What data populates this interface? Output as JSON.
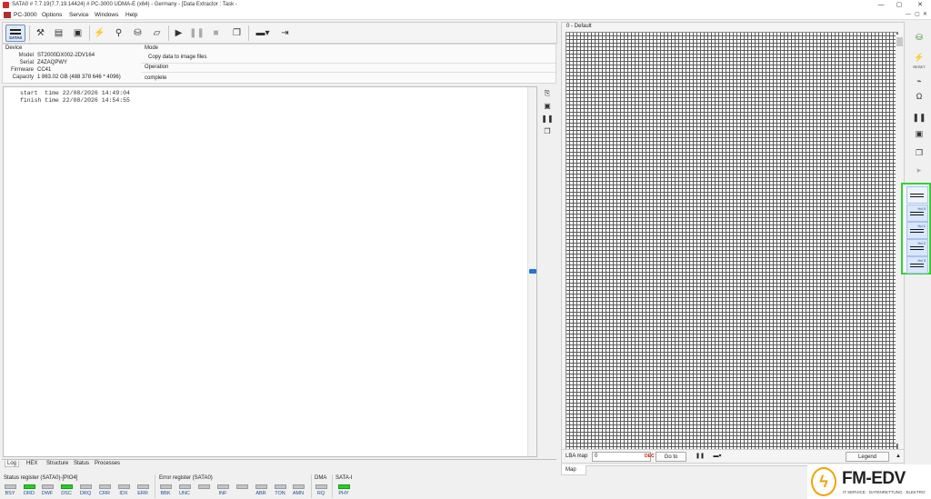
{
  "window": {
    "title": "SATA0 # 7.7.19(7.7.19.14424) # PC-3000 UDMA-E (x64) - Germany - [Data Extractor : Task - ",
    "controls": [
      "—",
      "▢",
      "✕"
    ]
  },
  "menu": {
    "items": [
      "PC-3000",
      "Options",
      "Service",
      "Windows",
      "Help"
    ],
    "sub_controls": [
      "—",
      "▢",
      "✕"
    ]
  },
  "toolbar": {
    "sata_label": "SATA0"
  },
  "device": {
    "section_label": "Device",
    "fields": [
      {
        "key": "Model",
        "value": "ST2000DX002-2DV164"
      },
      {
        "key": "Serial",
        "value": "Z4ZAQPWY"
      },
      {
        "key": "Firmware",
        "value": "CC41"
      },
      {
        "key": "Capacity",
        "value": "1 863.02 GB (488 378 646 * 4096)"
      }
    ],
    "mode_label": "Mode",
    "mode_value": "Copy data to image files",
    "operation_label": "Operation",
    "operation_value": "complete"
  },
  "log": {
    "lines": [
      "start  time 22/08/2026 14:49:04",
      "finish time 22/08/2026 14:54:55"
    ]
  },
  "tabs": [
    "Log",
    "HEX",
    "Structure",
    "Status",
    "Processes"
  ],
  "status_register": {
    "title": "Status register (SATA0)-[PIO4]",
    "leds": [
      {
        "label": "BSY",
        "on": false
      },
      {
        "label": "DRD",
        "on": true
      },
      {
        "label": "DWF",
        "on": false
      },
      {
        "label": "DSC",
        "on": true
      },
      {
        "label": "DRQ",
        "on": false
      },
      {
        "label": "CRR",
        "on": false
      },
      {
        "label": "IDX",
        "on": false
      },
      {
        "label": "ERR",
        "on": false
      }
    ]
  },
  "error_register": {
    "title": "Error register (SATA0)",
    "leds": [
      {
        "label": "BBK",
        "on": false
      },
      {
        "label": "UNC",
        "on": false
      },
      {
        "label": "",
        "on": false
      },
      {
        "label": "INF",
        "on": false
      },
      {
        "label": "",
        "on": false
      },
      {
        "label": "ABR",
        "on": false
      },
      {
        "label": "TON",
        "on": false
      },
      {
        "label": "AMN",
        "on": false
      }
    ]
  },
  "dma": {
    "title": "DMA",
    "led": {
      "label": "RQ",
      "on": false
    }
  },
  "sata": {
    "title": "SATA-I",
    "led": {
      "label": "PHY",
      "on": true
    }
  },
  "map": {
    "title": "0 - Default",
    "tab": "Map",
    "lba_label": "LBA map",
    "lba_value": "0",
    "dec_label": "DEC",
    "goto_label": "Go to",
    "legend_label": "Legend"
  },
  "right_toolbar": {
    "reset_label": "RESET",
    "heads": [
      "Hd 0",
      "Hd 1",
      "Hd 2",
      "Hd 3"
    ]
  },
  "logo": {
    "name": "FM-EDV",
    "tagline": "IT SERVICE · DATENRETTUNG · ELEKTRO"
  },
  "colors": {
    "led_on": "#23d123",
    "heads_highlight": "#35d135",
    "logo_accent": "#f2a400",
    "title_icon": "#d62828"
  }
}
